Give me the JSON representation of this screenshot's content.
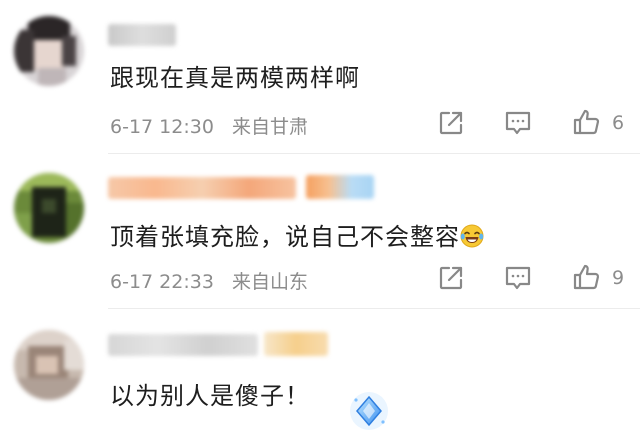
{
  "comments": [
    {
      "text": "跟现在真是两模两样啊",
      "time": "6-17 12:30",
      "location": "来自甘肃",
      "likes": "6",
      "avatar_icon": "blurred-avatar"
    },
    {
      "text": "顶着张填充脸，说自己不会整容",
      "emoji": "laughing-tears-emoji",
      "time": "6-17 22:33",
      "location": "来自山东",
      "likes": "9",
      "avatar_icon": "blurred-avatar"
    },
    {
      "text": "以为别人是傻子！",
      "badge_icon": "diamond-badge-icon",
      "avatar_icon": "blurred-avatar"
    }
  ],
  "icons": {
    "share": "share-icon",
    "comment": "comment-icon",
    "like": "thumbs-up-icon"
  },
  "colors": {
    "meta_text": "#8c8c8c",
    "icon_stroke": "#888888",
    "body_text": "#1e1e1e"
  }
}
